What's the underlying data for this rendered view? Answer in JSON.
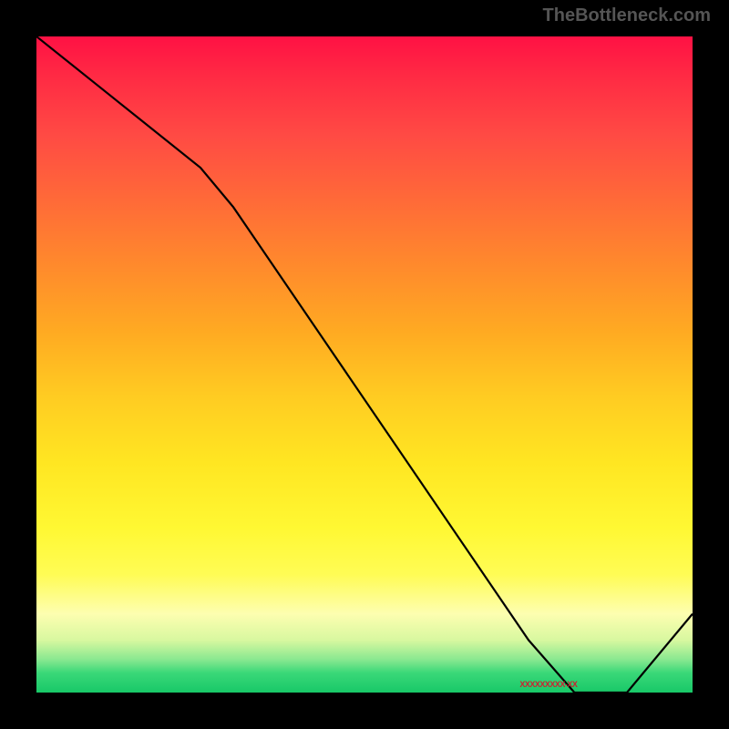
{
  "attribution": "TheBottleneck.com",
  "chart_data": {
    "type": "line",
    "title": "",
    "xlabel": "",
    "ylabel": "",
    "xlim": [
      0,
      100
    ],
    "ylim": [
      0,
      100
    ],
    "x": [
      0,
      25,
      30,
      75,
      82,
      90,
      100
    ],
    "values": [
      100,
      80,
      74,
      8,
      0,
      0,
      12
    ],
    "marker": {
      "label": "XXXXXXXXX-XX",
      "x": 82
    },
    "gradient_colors": [
      "#ff1144",
      "#ffaa22",
      "#fff833",
      "#18c868"
    ]
  }
}
